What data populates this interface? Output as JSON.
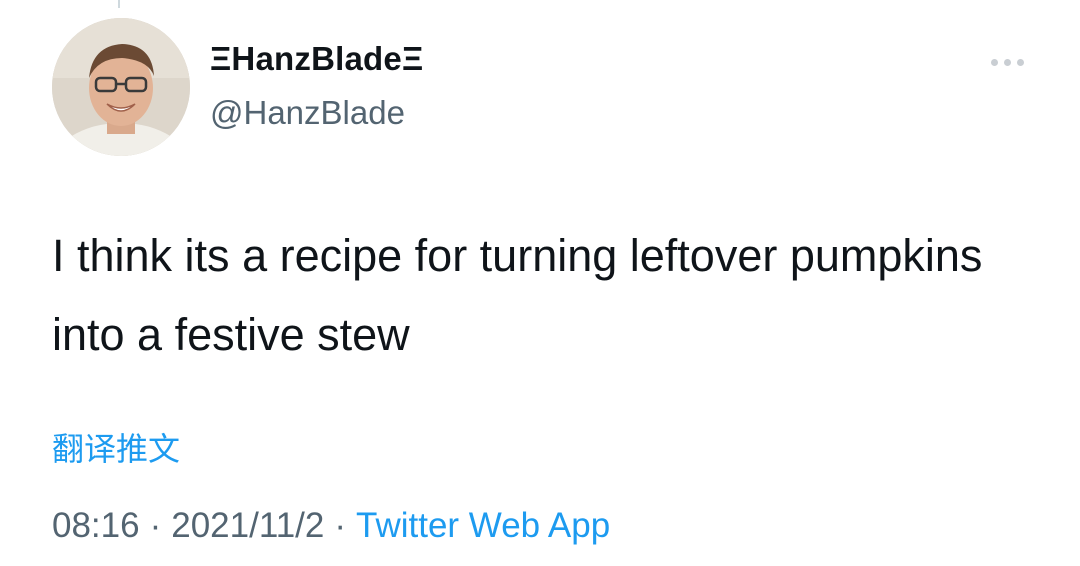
{
  "author": {
    "display_name": "ΞHanzBladeΞ",
    "handle": "@HanzBlade",
    "avatar_icon": "user-avatar"
  },
  "tweet": {
    "text": "I think its a recipe for turning leftover pumpkins into a festive stew",
    "translate_label": "翻译推文"
  },
  "meta": {
    "time": "08:16",
    "separator": "·",
    "date": "2021/11/2",
    "source": "Twitter Web App"
  },
  "more_menu": {
    "icon": "more-dots-icon"
  },
  "colors": {
    "link": "#1d9bf0",
    "secondary_text": "#536471",
    "primary_text": "#0f1419"
  }
}
